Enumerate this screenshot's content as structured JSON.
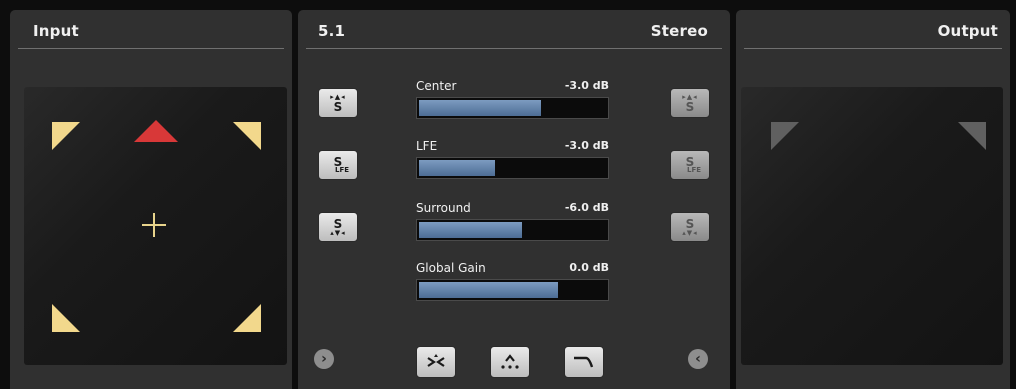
{
  "input": {
    "title": "Input",
    "speakers": [
      {
        "name": "front-left",
        "color": "#f2d88c"
      },
      {
        "name": "center",
        "color": "#d83838"
      },
      {
        "name": "front-right",
        "color": "#f2d88c"
      },
      {
        "name": "surround-left",
        "color": "#f2d88c"
      },
      {
        "name": "surround-right",
        "color": "#f2d88c"
      }
    ],
    "expand_icon": "chevron-right-icon"
  },
  "center": {
    "input_format": "5.1",
    "output_format": "Stereo",
    "left_buttons": [
      {
        "icon": "center-solo-icon",
        "text": "S"
      },
      {
        "icon": "lfe-solo-icon",
        "text": "S",
        "sub": "LFE"
      },
      {
        "icon": "surround-solo-icon",
        "text": "S"
      }
    ],
    "right_buttons": [
      {
        "icon": "center-solo-icon",
        "text": "S"
      },
      {
        "icon": "lfe-solo-icon",
        "text": "S",
        "sub": "LFE"
      },
      {
        "icon": "surround-solo-icon",
        "text": "S"
      }
    ],
    "meters": [
      {
        "label": "Center",
        "value": "-3.0 dB",
        "level": 0.66
      },
      {
        "label": "LFE",
        "value": "-3.0 dB",
        "level": 0.42
      },
      {
        "label": "Surround",
        "value": "-6.0 dB",
        "level": 0.56
      },
      {
        "label": "Global Gain",
        "value": "0.0 dB",
        "level": 0.75
      }
    ],
    "bottom_buttons": [
      {
        "icon": "mix-down-icon"
      },
      {
        "icon": "surround-mix-icon"
      },
      {
        "icon": "lowpass-filter-icon"
      }
    ],
    "left_nav_icon": "chevron-right-icon",
    "right_nav_icon": "chevron-left-icon"
  },
  "output": {
    "title": "Output",
    "speakers": [
      {
        "name": "left",
        "color": "#606060"
      },
      {
        "name": "right",
        "color": "#606060"
      }
    ]
  },
  "colors": {
    "panel": "#303030",
    "meter_fill": "#5b7ba3",
    "speaker_active": "#f2d88c",
    "speaker_center": "#d83838"
  }
}
